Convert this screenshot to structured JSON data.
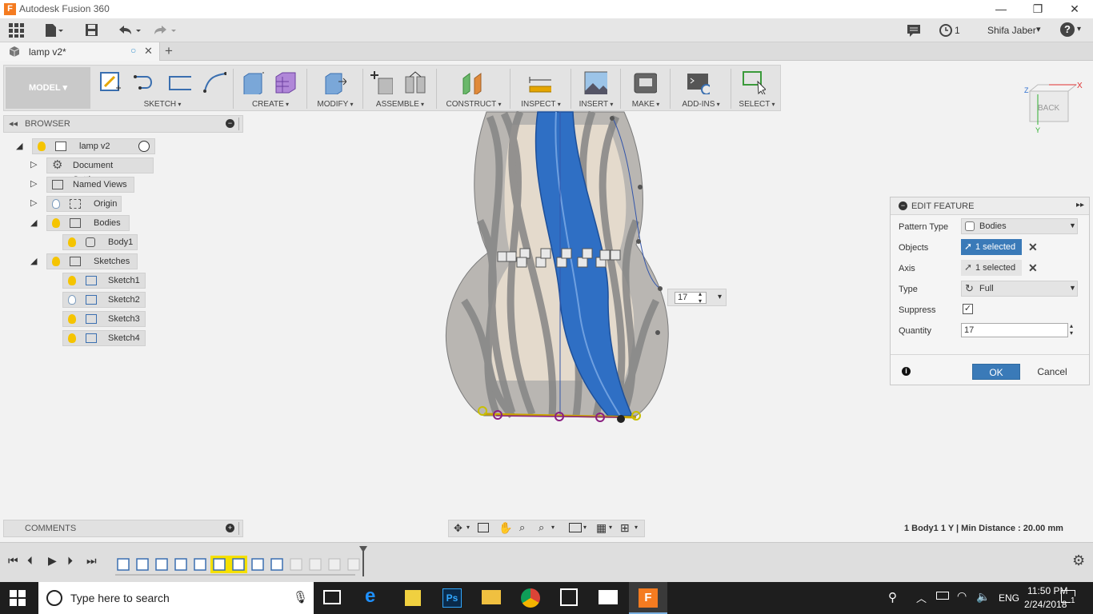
{
  "window": {
    "title": "Autodesk Fusion 360",
    "app_icon_letter": "F",
    "minimize": "—",
    "restore": "❐",
    "close": "✕"
  },
  "quickbar": {
    "job_count": "1",
    "user_name": "Shifa Jaber",
    "user_caret": "▾",
    "help_label": "?"
  },
  "document_tab": {
    "name": "lamp v2*",
    "new_tab": "+"
  },
  "toolbar": {
    "workspace": "MODEL",
    "groups": [
      "SKETCH",
      "CREATE",
      "MODIFY",
      "ASSEMBLE",
      "CONSTRUCT",
      "INSPECT",
      "INSERT",
      "MAKE",
      "ADD-INS",
      "SELECT"
    ]
  },
  "browser": {
    "title": "BROWSER",
    "root": "lamp v2",
    "items": [
      {
        "label": "Document Settings"
      },
      {
        "label": "Named Views"
      },
      {
        "label": "Origin"
      },
      {
        "label": "Bodies"
      },
      {
        "label": "Body1"
      },
      {
        "label": "Sketches"
      },
      {
        "label": "Sketch1"
      },
      {
        "label": "Sketch2"
      },
      {
        "label": "Sketch3"
      },
      {
        "label": "Sketch4"
      }
    ]
  },
  "viewcube": {
    "face": "BACK",
    "axis_x": "X",
    "axis_y": "Y",
    "axis_z": "Z"
  },
  "canvas_quantity": "17",
  "edit_feature": {
    "title": "EDIT FEATURE",
    "pattern_type_label": "Pattern Type",
    "pattern_type_value": "Bodies",
    "objects_label": "Objects",
    "objects_value": "1 selected",
    "axis_label": "Axis",
    "axis_value": "1 selected",
    "type_label": "Type",
    "type_value": "Full",
    "suppress_label": "Suppress",
    "quantity_label": "Quantity",
    "quantity_value": "17",
    "ok": "OK",
    "cancel": "Cancel"
  },
  "comments": {
    "title": "COMMENTS"
  },
  "status": {
    "text": "1 Body1 1 Y | Min Distance : 20.00 mm"
  },
  "taskbar": {
    "search_placeholder": "Type here to search",
    "time": "11:50 PM",
    "date": "2/24/2018",
    "language": "ENG",
    "notifications": "1"
  },
  "colors": {
    "accent_blue": "#3a7ab8",
    "fusion_orange": "#f47b20",
    "lamp_gray": "#8a8a8a",
    "lamp_blue": "#2f6fc4"
  }
}
